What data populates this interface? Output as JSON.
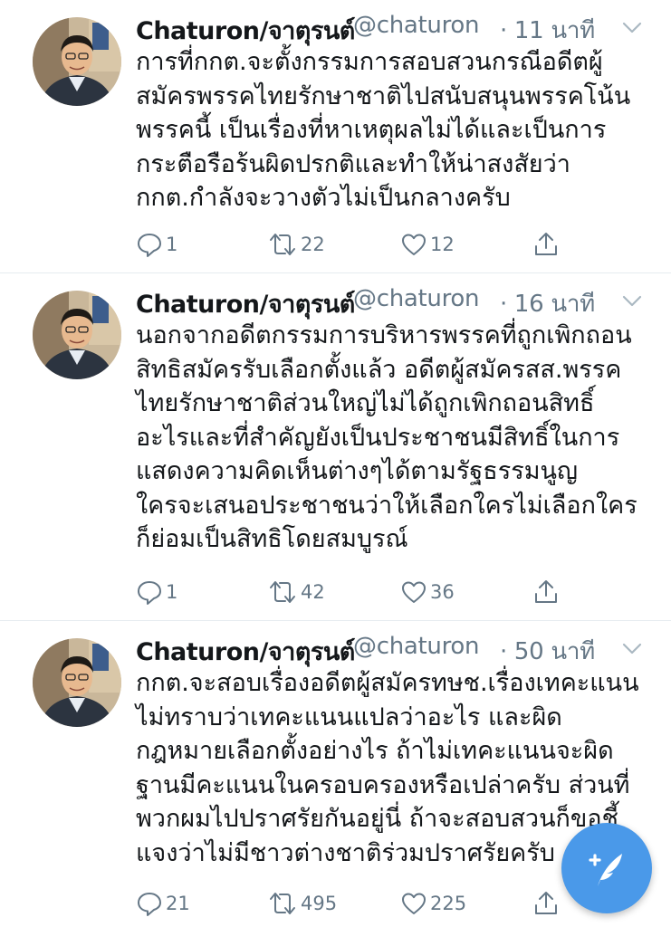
{
  "tweets": [
    {
      "author": {
        "name": "Chaturon/จาตุรนต์",
        "handle": "@chaturon"
      },
      "time": "· 11 นาที",
      "text": "การที่กกต.จะตั้งกรรมการสอบสวนกรณีอดีตผู้\nสมัครพรรคไทยรักษาชาติไปสนับสนุนพรรคโน้น\nพรรคนี้ เป็นเรื่องที่หาเหตุผลไม่ได้และเป็นการ\nกระตือรือร้นผิดปรกติและทำให้น่าสงสัยว่า\nกกต.กำลังจะวางตัวไม่เป็นกลางครับ",
      "replies": "1",
      "retweets": "22",
      "likes": "12"
    },
    {
      "author": {
        "name": "Chaturon/จาตุรนต์",
        "handle": "@chaturon"
      },
      "time": "· 16 นาที",
      "text": "นอกจากอดีตกรรมการบริหารพรรคที่ถูกเพิกถอน\nสิทธิสมัครรับเลือกตั้งแล้ว อดีตผู้สมัครสส.พรรค\nไทยรักษาชาติส่วนใหญ่ไม่ได้ถูกเพิกถอนสิทธิ์\nอะไรและที่สำคัญยังเป็นประชาชนมีสิทธิ์ในการ\nแสดงความคิดเห็นต่างๆได้ตามรัฐธรรมนูญ\nใครจะเสนอประชาชนว่าให้เลือกใครไม่เลือกใคร\nก็ย่อมเป็นสิทธิโดยสมบูรณ์",
      "replies": "1",
      "retweets": "42",
      "likes": "36"
    },
    {
      "author": {
        "name": "Chaturon/จาตุรนต์",
        "handle": "@chaturon"
      },
      "time": "· 50 นาที",
      "text": "กกต.จะสอบเรื่องอดีตผู้สมัครทษช.เรื่องเทคะแนน\nไม่ทราบว่าเทคะแนนแปลว่าอะไร และผิด\nกฎหมายเลือกตั้งอย่างไร ถ้าไม่เทคะแนนจะผิด\nฐานมีคะแนนในครอบครองหรือเปล่าครับ ส่วนที่\nพวกผมไปปราศรัยกันอยู่นี่ ถ้าจะสอบสวนก็ขอชี้\nแจงว่าไม่มีชาวต่างชาติร่วมปราศรัยครับ",
      "replies": "21",
      "retweets": "495",
      "likes": "225"
    }
  ],
  "icons": {
    "reply": "reply-icon",
    "retweet": "retweet-icon",
    "like": "heart-icon",
    "share": "share-icon",
    "compose": "compose-tweet-icon",
    "caret": "chevron-down-icon"
  },
  "colors": {
    "accent": "#4a99e9",
    "text": "#14171a",
    "secondary": "#657786",
    "divider": "#e6ecf0"
  }
}
